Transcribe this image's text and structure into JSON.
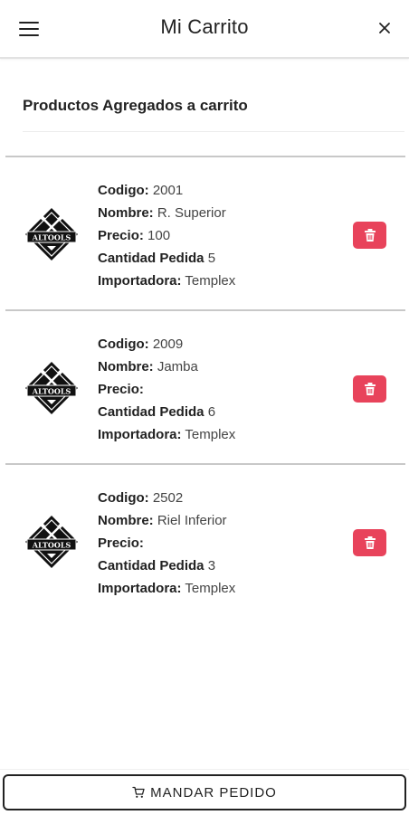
{
  "header": {
    "title": "Mi Carrito",
    "menu_icon": "hamburger-menu-icon",
    "close_icon": "close-icon"
  },
  "section": {
    "title": "Productos Agregados a carrito"
  },
  "labels": {
    "codigo": "Codigo:",
    "nombre": "Nombre:",
    "precio": "Precio:",
    "cantidad": "Cantidad Pedida",
    "importadora": "Importadora:"
  },
  "items": [
    {
      "codigo": "2001",
      "nombre": "R. Superior",
      "precio": "100",
      "cantidad": "5",
      "importadora": "Templex",
      "logo_text": "ALTOOLS"
    },
    {
      "codigo": "2009",
      "nombre": "Jamba",
      "precio": "",
      "cantidad": "6",
      "importadora": "Templex",
      "logo_text": "ALTOOLS"
    },
    {
      "codigo": "2502",
      "nombre": "Riel Inferior",
      "precio": "",
      "cantidad": "3",
      "importadora": "Templex",
      "logo_text": "ALTOOLS"
    }
  ],
  "footer": {
    "send_label": "MANDAR PEDIDO",
    "send_icon": "cart-icon"
  },
  "colors": {
    "delete": "#e8435b",
    "text": "#222222",
    "divider": "#c8c8c8"
  }
}
